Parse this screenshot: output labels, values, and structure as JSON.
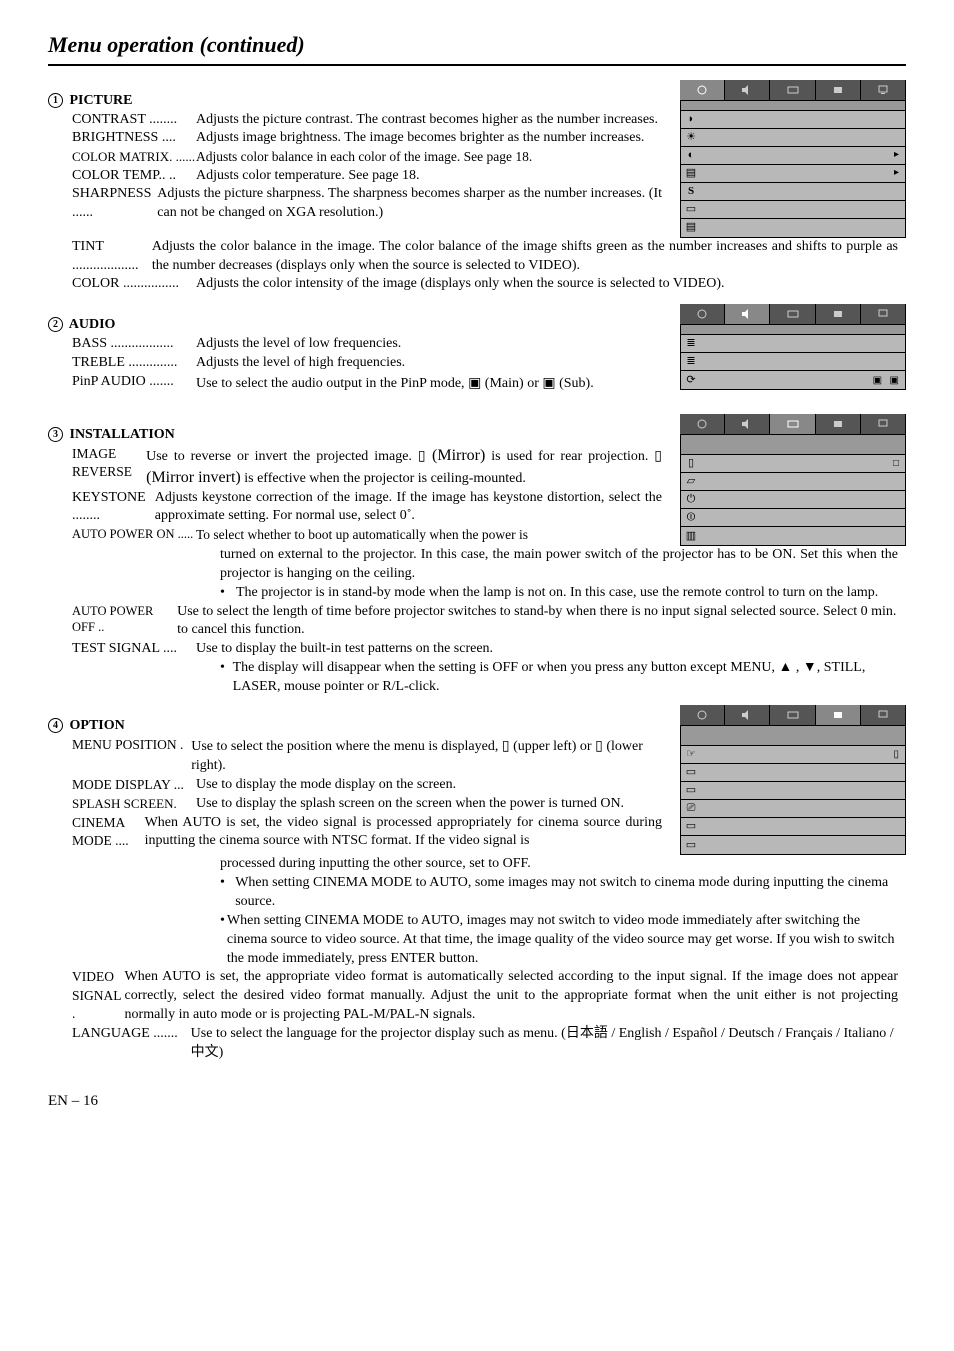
{
  "page_title": "Menu operation (continued)",
  "page_number": "EN – 16",
  "sec1": {
    "num": "1",
    "title": "PICTURE",
    "contrast_label": "CONTRAST",
    "contrast_dots": " ........",
    "contrast_desc": "Adjusts the picture contrast. The contrast becomes higher as the number increases.",
    "brightness_label": "BRIGHTNESS",
    "brightness_dots": " ....",
    "brightness_desc": "Adjusts image brightness. The image becomes brighter as the number increases.",
    "cmatrix_label": "COLOR MATRIX.",
    "cmatrix_dots": " ......",
    "cmatrix_desc": "Adjusts color balance in each color of the image. See page 18.",
    "ctemp_label": "COLOR TEMP..",
    "ctemp_dots": " ..",
    "ctemp_desc": "Adjusts color temperature. See page 18.",
    "sharp_label": "SHARPNESS",
    "sharp_dots": " ......",
    "sharp_desc": "Adjusts the picture sharpness. The sharpness becomes sharper as the number increases.  (It can not be changed on XGA resolution.)",
    "tint_label": "TINT",
    "tint_dots": " ...................",
    "tint_desc": "Adjusts the color balance in the image.  The color balance of the image shifts green as the number increases and shifts to purple as the number decreases (displays only when the source is selected to VIDEO).",
    "color_label": "COLOR",
    "color_dots": " ................",
    "color_desc": "Adjusts the color intensity of the image (displays only when the source is selected to VIDEO)."
  },
  "sec2": {
    "num": "2",
    "title": "AUDIO",
    "bass_label": "BASS",
    "bass_dots": " ..................",
    "bass_desc": "Adjusts the level of low frequencies.",
    "treble_label": "TREBLE",
    "treble_dots": " ..............",
    "treble_desc": "Adjusts the level of high frequencies.",
    "pinp_label": "PinP AUDIO",
    "pinp_dots": " .......",
    "pinp_desc_a": "Use to select the audio output in the PinP mode, ",
    "pinp_main": " (Main)",
    "pinp_desc_b": "or ",
    "pinp_sub": " (Sub)."
  },
  "sec3": {
    "num": "3",
    "title": "INSTALLATION",
    "imgrev_label": "IMAGE REVERSE",
    "imgrev_desc_a": "Use to reverse or invert the projected image.  ",
    "imgrev_mirror": " (Mirror)",
    "imgrev_desc_b": " is used for rear projection.  ",
    "imgrev_mirrorinv": " (Mirror invert)",
    "imgrev_desc_c": " is effective when the projector is ceiling-mounted.",
    "keystone_label": "KEYSTONE",
    "keystone_dots": " ........",
    "keystone_desc": "Adjusts keystone correction of the image. If the image has keystone distortion, select the approximate setting. For normal use, select 0˚.",
    "apon_label": "AUTO POWER ON",
    "apon_dots": " .....",
    "apon_desc": "To select whether to boot up automatically when the power is turned on external to the projector. In this case, the main power switch of the projector has to be ON.  Set this when the projector is hanging on the ceiling.",
    "apon_bullet": "The projector is in stand-by mode when the lamp is not on. In this case, use the remote control to turn on the lamp.",
    "apoff_label": "AUTO POWER OFF",
    "apoff_dots": " ..",
    "apoff_desc": "Use to select the length of time before projector switches to stand-by when there is no input signal selected source. Select 0 min. to cancel this function.",
    "test_label": "TEST SIGNAL",
    "test_dots": " ....",
    "test_desc": "Use to display the built-in test patterns on the screen.",
    "test_bullet": "The display will disappear when the setting is OFF or when you press any button except MENU,  ▲ , ▼, STILL, LASER, mouse pointer or R/L-click."
  },
  "sec4": {
    "num": "4",
    "title": "OPTION",
    "menupos_label": "MENU POSITION",
    "menupos_dots": " .",
    "menupos_desc_a": "Use to select the position where the menu is displayed, ",
    "menupos_ul": " (upper left) or ",
    "menupos_lr": " (lower right).",
    "mode_label": "MODE DISPLAY",
    "mode_dots": " ...",
    "mode_desc": "Use to display the mode display on the screen.",
    "splash_label": "SPLASH SCREEN",
    "splash_dots": ".",
    "splash_desc": "Use to display the splash screen on the screen when the power is turned ON.",
    "cinema_label": "CINEMA MODE",
    "cinema_dots": " ....",
    "cinema_desc": "When AUTO is set, the video signal is processed appropriately for cinema source during inputting the cinema source with NTSC format. If the video signal is processed during inputting the other source, set to OFF.",
    "cinema_b1": "When setting CINEMA MODE to AUTO, some images may not switch to cinema mode during inputting the cinema source.",
    "cinema_b2": "When setting CINEMA MODE to AUTO, images may not switch to video mode immediately after switching the cinema source to video source. At that time, the image quality of the video source may get worse. If you wish to switch the mode immediately, press ENTER button.",
    "vsig_label": "VIDEO SIGNAL",
    "vsig_dots": " .",
    "vsig_desc": "When AUTO is set, the appropriate video format is automatically selected according to the input signal. If the image does not appear correctly, select the desired video format manually. Adjust the unit to the appropriate format when the unit either is not projecting normally in auto mode or is projecting PAL-M/PAL-N signals.",
    "lang_label": "LANGUAGE",
    "lang_dots": " .......",
    "lang_desc": "Use to select the language for the projector display such as menu. (日本語 / English / Español / Deutsch / Français / Italiano / 中文)"
  }
}
